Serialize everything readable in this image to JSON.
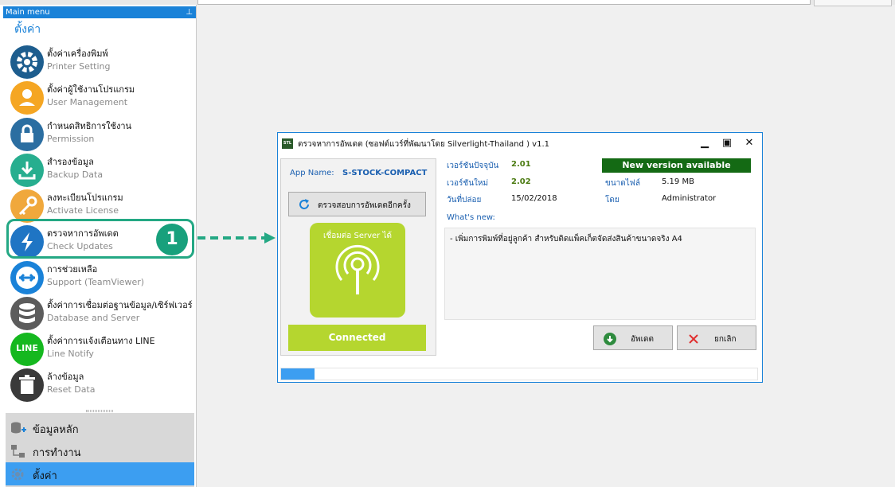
{
  "sidebar": {
    "header": "Main menu",
    "pin_icon": "pin-icon",
    "section_title": "ตั้งค่า",
    "items": [
      {
        "label": "ตั้งค่าเครื่องพิมพ์",
        "sub": "Printer Setting",
        "icon": "gear-icon",
        "color": "#1d5d8e"
      },
      {
        "label": "ตั้งค่าผู้ใช้งานโปรแกรม",
        "sub": "User Management",
        "icon": "user-icon",
        "color": "#f5a623"
      },
      {
        "label": "กำหนดสิทธิการใช้งาน",
        "sub": "Permission",
        "icon": "lock-icon",
        "color": "#2b6ea1"
      },
      {
        "label": "สำรองข้อมูล",
        "sub": "Backup Data",
        "icon": "download-icon",
        "color": "#27ae8f"
      },
      {
        "label": "ลงทะเบียนโปรแกรม",
        "sub": "Activate License",
        "icon": "key-icon",
        "color": "#f0a83c"
      },
      {
        "label": "ตรวจหาการอัพเดต",
        "sub": "Check Updates",
        "icon": "update-icon",
        "color": "#1f75c4"
      },
      {
        "label": "การช่วยเหลือ",
        "sub": "Support (TeamViewer)",
        "icon": "teamviewer-icon",
        "color": "#1a82d8"
      },
      {
        "label": "ตั้งค่าการเชื่อมต่อฐานข้อมูล/เซิร์ฟเวอร์",
        "sub": "Database and Server",
        "icon": "database-icon",
        "color": "#5c5c5c"
      },
      {
        "label": "ตั้งค่าการแจ้งเตือนทาง LINE",
        "sub": "Line Notify",
        "icon": "line-icon",
        "color": "#15b81f",
        "icon_text": "LINE"
      },
      {
        "label": "ล้างข้อมูล",
        "sub": "Reset Data",
        "icon": "trash-icon",
        "color": "#3a3a3a"
      }
    ],
    "bottom": [
      {
        "label": "ข้อมูลหลัก",
        "icon": "master-data-icon"
      },
      {
        "label": "การทำงาน",
        "icon": "workflow-icon"
      },
      {
        "label": "ตั้งค่า",
        "icon": "settings-icon",
        "active": true
      }
    ]
  },
  "callout": {
    "number": "1",
    "color": "#18a07c"
  },
  "dialog": {
    "logo": "STL",
    "title": "ตรวจหาการอัพเดต (ซอฟต์แวร์ที่พัฒนาโดย Silverlight-Thailand ) v1.1",
    "controls": [
      "▁",
      "▣",
      "✕"
    ],
    "app_name_label": "App Name:",
    "app_name_value": "S-STOCK-COMPACT",
    "check_button": "ตรวจสอบการอัพเดตอีกครั้ง",
    "tile_text": "เชื่อมต่อ Server ได้",
    "status": "Connected",
    "info": {
      "current_label": "เวอร์ชันปัจจุบัน",
      "current_value": "2.01",
      "new_label": "เวอร์ชันใหม่",
      "new_value": "2.02",
      "release_label": "วันที่ปล่อย",
      "release_value": "15/02/2018",
      "size_label": "ขนาดไฟล์",
      "size_value": "5.19 MB",
      "by_label": "โดย",
      "by_value": "Administrator",
      "whats_new_label": "What's new:",
      "whats_new_text": "- เพิ่มการพิมพ์ที่อยู่ลูกค้า สำหรับติดแพ็คเก็ตจัดส่งสินค้าขนาดจริง  A4"
    },
    "new_version_badge": "New version available",
    "update_button": "อัพเดต",
    "cancel_button": "ยกเลิก",
    "progress": 0.07
  }
}
